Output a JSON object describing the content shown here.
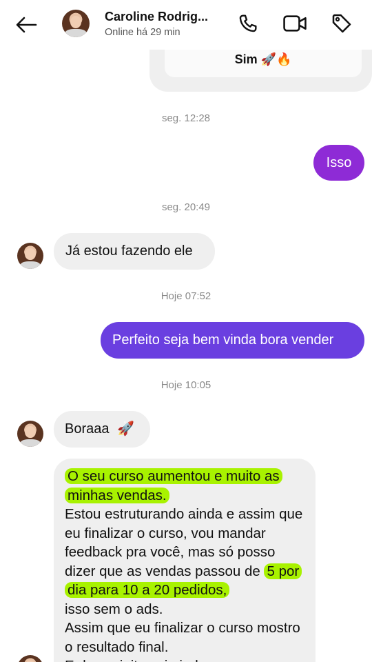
{
  "header": {
    "contact_name": "Caroline Rodrig...",
    "status": "Online há 29 min"
  },
  "quoted": {
    "text": "Sim 🚀🔥"
  },
  "messages": {
    "stamp1": "seg. 12:28",
    "out1": "Isso",
    "stamp2": "seg. 20:49",
    "in1": "Já estou fazendo ele",
    "stamp3": "Hoje 07:52",
    "out2": "Perfeito seja bem vinda bora vender",
    "stamp4": "Hoje 10:05",
    "in2": "Boraaa",
    "in2_emoji": "🚀",
    "long": {
      "hl1": "O seu curso aumentou e muito as minhas vendas.",
      "p1": "Estou estruturando ainda e assim que eu finalizar o curso, vou mandar feedback pra você, mas só posso dizer que as vendas passou de ",
      "hl2": "5 por dia para 10 a 20 pedidos,",
      "p2": "isso sem o ads.",
      "p3": "Assim que eu finalizar o curso mostro o resultado final.",
      "p4": "E desse jeito sai ainda"
    }
  },
  "colors": {
    "out_purple": "#8e2bd6",
    "out_indigo": "#6a3fe0",
    "incoming": "#efefef",
    "highlight": "#a8f200"
  },
  "icons": [
    "back-arrow-icon",
    "phone-icon",
    "video-icon",
    "tag-icon"
  ]
}
